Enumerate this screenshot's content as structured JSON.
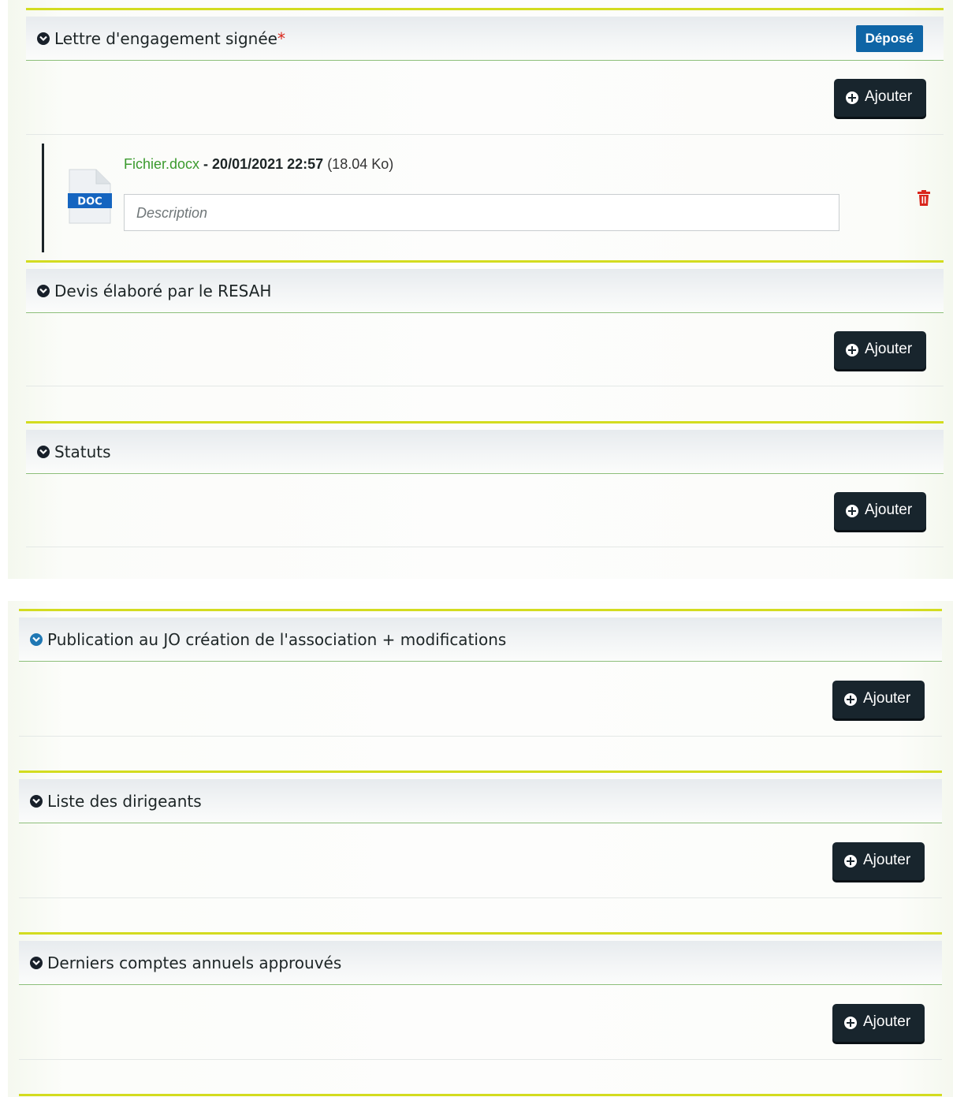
{
  "sections_top": [
    {
      "title": "Lettre d'engagement signée",
      "required_mark": "*",
      "badge": "Déposé",
      "add_label": "Ajouter",
      "file": {
        "name": "Fichier.docx",
        "separator": " - ",
        "date": "20/01/2021 22:57",
        "size": " (18.04 Ko)",
        "type_label": "DOC",
        "description_placeholder": "Description"
      }
    },
    {
      "title": "Devis élaboré par le RESAH",
      "add_label": "Ajouter"
    },
    {
      "title": "Statuts",
      "add_label": "Ajouter"
    }
  ],
  "sections_bottom": [
    {
      "title": "Publication au JO création de l'association + modifications",
      "add_label": "Ajouter"
    },
    {
      "title": "Liste des dirigeants",
      "add_label": "Ajouter"
    },
    {
      "title": "Derniers comptes annuels approuvés",
      "add_label": "Ajouter"
    }
  ],
  "colors": {
    "accent_line": "#d3dc1f",
    "badge": "#0f65a6",
    "button": "#18252d",
    "file_link": "#3b9a2e",
    "trash": "#d9261c"
  }
}
